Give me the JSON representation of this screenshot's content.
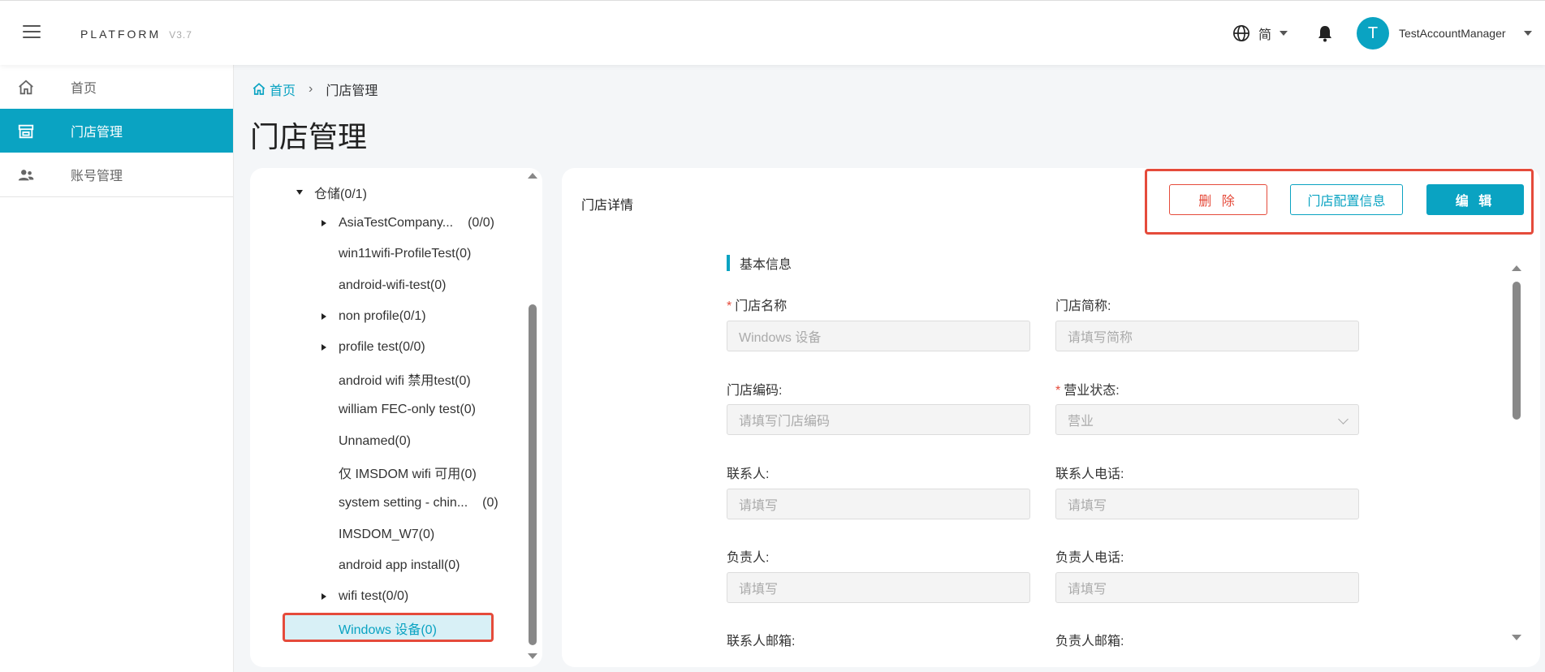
{
  "header": {
    "brand": "PLATFORM",
    "version": "V3.7",
    "language": "简",
    "avatar_letter": "T",
    "username": "TestAccountManager"
  },
  "sidebar": {
    "items": [
      {
        "label": "首页",
        "icon": "home-icon"
      },
      {
        "label": "门店管理",
        "icon": "store-icon",
        "active": true
      },
      {
        "label": "账号管理",
        "icon": "users-icon"
      }
    ]
  },
  "breadcrumb": {
    "home": "首页",
    "current": "门店管理"
  },
  "page_title": "门店管理",
  "tree": {
    "items": [
      {
        "label": "仓储(0/1)"
      },
      {
        "label": "AsiaTestCompany...",
        "count": "(0/0)"
      },
      {
        "label": "win11wifi-ProfileTest(0)"
      },
      {
        "label": "android-wifi-test(0)"
      },
      {
        "label": "non profile(0/1)"
      },
      {
        "label": "profile test(0/0)"
      },
      {
        "label": "android wifi 禁用test(0)"
      },
      {
        "label": "william FEC-only test(0)"
      },
      {
        "label": "Unnamed(0)"
      },
      {
        "label": "仅 IMSDOM wifi 可用(0)"
      },
      {
        "label": "system setting - chin...",
        "count": "(0)"
      },
      {
        "label": "IMSDOM_W7(0)"
      },
      {
        "label": "android app install(0)"
      },
      {
        "label": "wifi test(0/0)"
      },
      {
        "label": "Windows 设备(0)",
        "selected": true
      }
    ]
  },
  "detail": {
    "title": "门店详情",
    "buttons": {
      "delete": "删 除",
      "config": "门店配置信息",
      "edit": "编 辑"
    },
    "section": "基本信息",
    "fields": {
      "store_name": {
        "label": "门店名称",
        "value": "Windows 设备"
      },
      "short_name": {
        "label": "门店简称:",
        "placeholder": "请填写简称"
      },
      "store_code": {
        "label": "门店编码:",
        "placeholder": "请填写门店编码"
      },
      "business_status": {
        "label": "营业状态:",
        "value": "营业"
      },
      "contact": {
        "label": "联系人:",
        "placeholder": "请填写"
      },
      "contact_phone": {
        "label": "联系人电话:",
        "placeholder": "请填写"
      },
      "manager": {
        "label": "负责人:",
        "placeholder": "请填写"
      },
      "manager_phone": {
        "label": "负责人电话:",
        "placeholder": "请填写"
      },
      "contact_email": {
        "label": "联系人邮箱:"
      },
      "manager_email": {
        "label": "负责人邮箱:"
      }
    }
  },
  "colors": {
    "accent": "#0aa3c2",
    "danger": "#e54b3b"
  }
}
